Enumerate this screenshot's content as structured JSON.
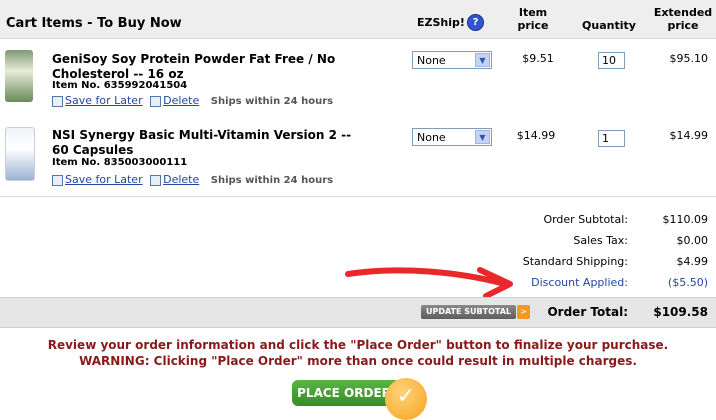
{
  "header": {
    "title": "Cart Items - To Buy Now",
    "ezship": "EZShip!",
    "item_price_1": "Item",
    "item_price_2": "price",
    "quantity": "Quantity",
    "extended_1": "Extended",
    "extended_2": "price"
  },
  "items": [
    {
      "name": "GeniSoy Soy Protein Powder Fat Free / No Cholesterol -- 16 oz",
      "item_no": "Item No. 635992041504",
      "save_label": "Save for Later",
      "delete_label": "Delete",
      "shipping": "Ships within 24 hours",
      "ezship": "None",
      "price": "$9.51",
      "quantity": "10",
      "extended": "$95.10"
    },
    {
      "name": "NSI Synergy Basic Multi-Vitamin Version 2 -- 60 Capsules",
      "item_no": "Item No. 835003000111",
      "save_label": "Save for Later",
      "delete_label": "Delete",
      "shipping": "Ships within 24 hours",
      "ezship": "None",
      "price": "$14.99",
      "quantity": "1",
      "extended": "$14.99"
    }
  ],
  "totals": {
    "subtotal_label": "Order Subtotal:",
    "subtotal": "$110.09",
    "tax_label": "Sales Tax:",
    "tax": "$0.00",
    "shipping_label": "Standard Shipping:",
    "shipping": "$4.99",
    "discount_label": "Discount Applied:",
    "discount": "($5.50)",
    "update_label": "UPDATE SUBTOTAL",
    "order_total_label": "Order Total:",
    "order_total": "$109.58"
  },
  "message": {
    "line1": "Review your order information and click the \"Place Order\" button to finalize your purchase.",
    "line2": "WARNING: Clicking \"Place Order\" more than once could result in multiple charges."
  },
  "place_order_label": "PLACE ORDER",
  "colors": {
    "annotation_arrow": "#e8282a",
    "link": "#2346a0",
    "warning": "#8a1a1a",
    "place_order": "#4aa23a",
    "check": "#f6a31d"
  }
}
